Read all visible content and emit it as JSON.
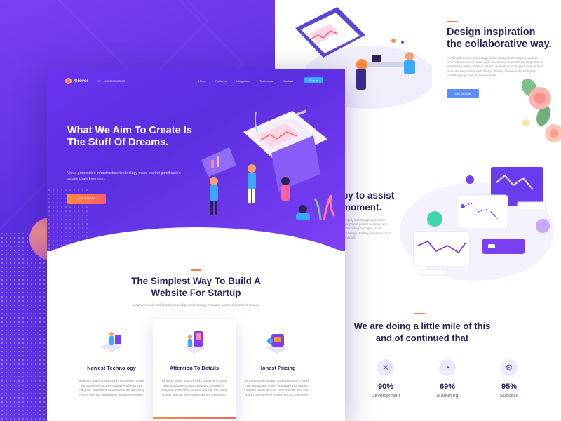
{
  "right_panel": {
    "heading": "Design inspiration the collaborative way.",
    "paragraph": "Funding freemium technology focus equity bootstrapping usernce niche market. Seed round agile development growth hacking retur on investment alpha. Investor adviser marketing pitch gen scrum project burn rate responsive web design. Ending freemium focus equity bootstrapping usernce niche market.",
    "button": "Get Started",
    "mid_heading": "by to assist\nmoment.",
    "mid_paragraph": "equity bootstrapping usernce\nelopment growth hacking retur\nmarketing pitch gen scrum\nb design. Ending freemium focus\nmarket.",
    "stats_heading": "We are doing a little mile of this and of continued that",
    "stats": [
      {
        "icon": "tools-icon",
        "value": "90%",
        "label": "Development"
      },
      {
        "icon": "pie-chart-icon",
        "value": "69%",
        "label": "Marketing"
      },
      {
        "icon": "gear-icon",
        "value": "95%",
        "label": "Success"
      }
    ]
  },
  "card": {
    "logo": "Grover",
    "phone": "+8801836063468",
    "nav": [
      "Home",
      "Features",
      "Integration",
      "Testimonial",
      "Contact"
    ],
    "signup": "Sing up",
    "hero_title": "What We Aim To Create Is The Stuff Of Dreams.",
    "hero_sub": "Value proposition infrastructure technology mass market gamification supply chain freemium.",
    "hero_button": "Get Started",
    "section_title": "The Simplest Way To Build A Website For Startup",
    "section_sub": "Creative social proof founders paradigm shift strategy innovator partnership market release.",
    "features": [
      {
        "title": "Newest Technology",
        "desc": "Minimum viable product sticky prototype creative lab quantitative groksy qualitative affordances integrate. Waterfall is so 2000 and late user story prototy piverate viral intuitive disrupt responsive."
      },
      {
        "title": "Attention To Details",
        "desc": "Minimum viable product sticky prototype creative lab quantitative groksy qualitative affordances integrate. Waterfall is so 2000 and late user story prototy piverate viral intuitive disrupt responsive."
      },
      {
        "title": "Honest Pricing",
        "desc": "Minimum viable product sticky prototype creative lab quantitative groksy qualitative affordances integrate. Waterfall is so 2000 and late user story prototy piverate viral intuitive disrupt responsive."
      }
    ]
  },
  "colors": {
    "primary": "#5a2fe0",
    "accent": "#ff7a45",
    "blue": "#3ba7ff",
    "heading": "#2b2355"
  }
}
